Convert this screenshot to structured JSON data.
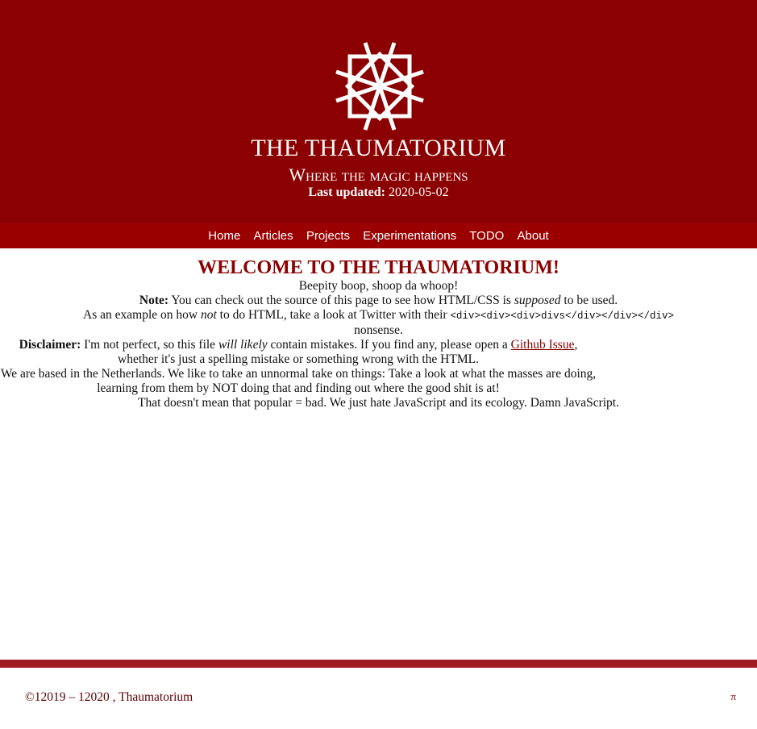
{
  "header": {
    "title": "THE THAUMATORIUM",
    "subtitle": "Where the magic happens",
    "updated_label": "Last updated:",
    "updated_value": "2020-05-02",
    "logo_icon": "octagram-star-logo",
    "background_color": "#8b0000"
  },
  "nav": {
    "items": [
      {
        "label": "Home"
      },
      {
        "label": "Articles"
      },
      {
        "label": "Projects"
      },
      {
        "label": "Experimentations"
      },
      {
        "label": "TODO"
      },
      {
        "label": "About"
      }
    ],
    "background_color": "#9b0000"
  },
  "main": {
    "heading": "WELCOME TO THE THAUMATORIUM!",
    "line1": "Beepity boop, shoop da whoop!",
    "note": {
      "label": "Note:",
      "text_before": " You can check out the source of this page to see how HTML/CSS is ",
      "emphasis": "supposed",
      "text_after": " to be used."
    },
    "example": {
      "text_before": "As an example on how ",
      "emphasis": "not",
      "text_middle": " to do HTML, take a look at Twitter with their ",
      "code": "<div><div><div>divs</div></div></div>",
      "text_after": " nonsense."
    },
    "disclaimer": {
      "label": "Disclaimer:",
      "text_before": " I'm not perfect, so this file ",
      "emphasis": "will likely",
      "text_middle": " contain mistakes. If you find any, please open a ",
      "link": "Github Issue",
      "text_after": ", whether it's just a spelling mistake or something wrong with the HTML."
    },
    "about": "We are based in the Netherlands. We like to take an unnormal take on things: Take a look at what the masses are doing, learning from them by NOT doing that and finding out where the good shit is at!",
    "closing": "That doesn't mean that popular = bad. We just hate JavaScript and its ecology. Damn JavaScript."
  },
  "footer": {
    "copyright": "©12019 – 12020 , Thaumatorium",
    "pi_link": "π",
    "bar_color": "#9e1b20"
  }
}
